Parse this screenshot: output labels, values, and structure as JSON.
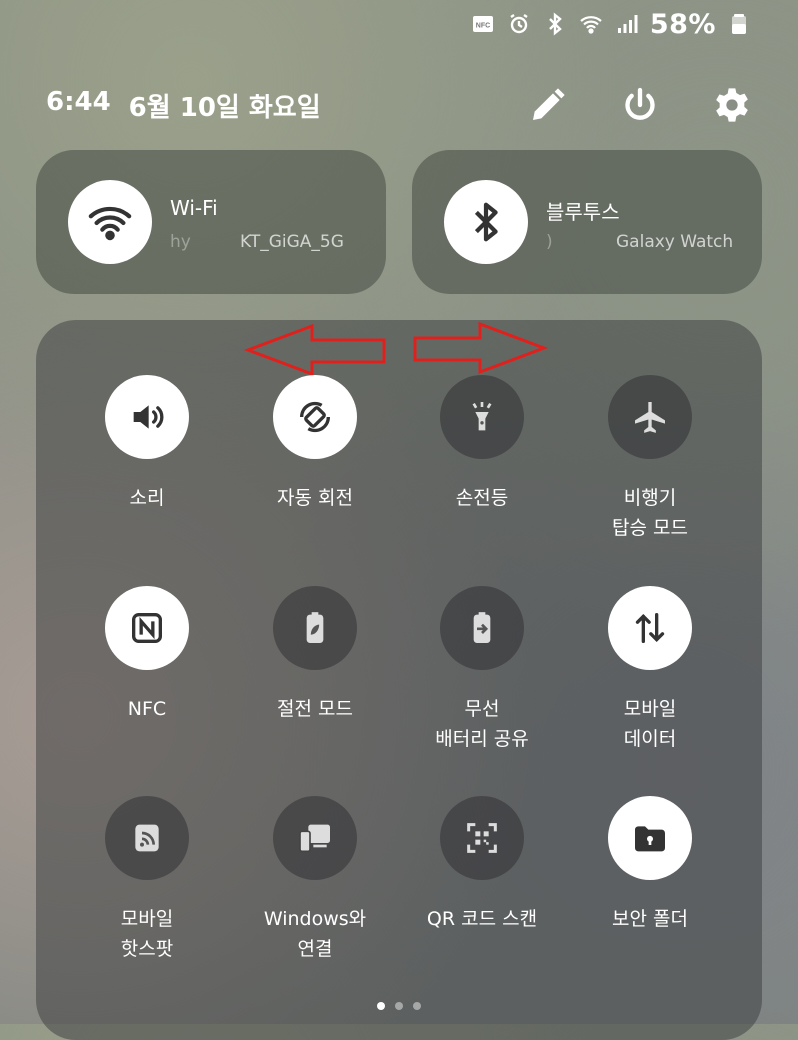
{
  "status_bar": {
    "icons": [
      "nfc-icon",
      "alarm-icon",
      "bluetooth-icon",
      "wifi-icon",
      "signal-icon"
    ],
    "battery_text": "58%"
  },
  "header": {
    "time": "6:44",
    "date": "6월 10일 화요일",
    "actions": [
      "edit-icon",
      "power-icon",
      "settings-icon"
    ]
  },
  "wifi_card": {
    "title": "Wi-Fi",
    "sub_prefix": "hy",
    "network": "KT_GiGA_5G"
  },
  "bt_card": {
    "title": "블루투스",
    "sub_prefix": ")",
    "device": "Galaxy Watch"
  },
  "tiles": [
    {
      "label": "소리",
      "icon": "sound-icon",
      "on": true
    },
    {
      "label": "자동 회전",
      "icon": "auto-rotate-icon",
      "on": true
    },
    {
      "label": "손전등",
      "icon": "flashlight-icon",
      "on": false
    },
    {
      "label": "비행기\n탑승 모드",
      "icon": "airplane-icon",
      "on": false
    },
    {
      "label": "NFC",
      "icon": "nfc-tile-icon",
      "on": true
    },
    {
      "label": "절전 모드",
      "icon": "power-saving-icon",
      "on": false
    },
    {
      "label": "무선\n배터리 공유",
      "icon": "wireless-powershare-icon",
      "on": false
    },
    {
      "label": "모바일\n데이터",
      "icon": "mobile-data-icon",
      "on": true
    },
    {
      "label": "모바일\n핫스팟",
      "icon": "hotspot-icon",
      "on": false
    },
    {
      "label": "Windows와\n연결",
      "icon": "link-windows-icon",
      "on": false
    },
    {
      "label": "QR 코드 스캔",
      "icon": "qr-scan-icon",
      "on": false
    },
    {
      "label": "보안 폴더",
      "icon": "secure-folder-icon",
      "on": true
    }
  ],
  "page_indicator": {
    "count": 3,
    "active": 0
  },
  "colors": {
    "accent_arrow": "#e0201c",
    "tile_on_bg": "#ffffff",
    "icon_dark": "#333333"
  }
}
